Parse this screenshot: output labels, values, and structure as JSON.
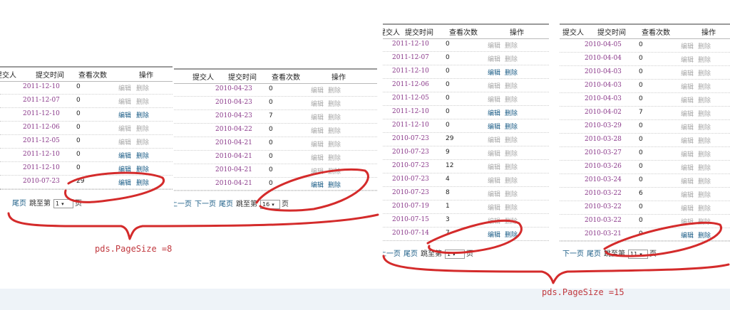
{
  "columns": {
    "submitter": "提交人",
    "time": "提交时间",
    "views": "查看次数",
    "ops": "操作"
  },
  "actions": {
    "edit": "编辑",
    "delete": "删除"
  },
  "pager": {
    "prev": "上一页",
    "next": "下一页",
    "last": "尾页",
    "goto": "跳至第",
    "page": "页"
  },
  "panels": [
    {
      "rows": [
        {
          "date": "2011-12-10",
          "views": "0",
          "active": false
        },
        {
          "date": "2011-12-07",
          "views": "0",
          "active": false
        },
        {
          "date": "2011-12-10",
          "views": "0",
          "active": true
        },
        {
          "date": "2011-12-06",
          "views": "0",
          "active": false
        },
        {
          "date": "2011-12-05",
          "views": "0",
          "active": false
        },
        {
          "date": "2011-12-10",
          "views": "0",
          "active": true
        },
        {
          "date": "2011-12-10",
          "views": "0",
          "active": true
        },
        {
          "date": "2010-07-23",
          "views": "29",
          "active": true
        }
      ],
      "page_select": "1"
    },
    {
      "rows": [
        {
          "date": "2010-04-23",
          "views": "0",
          "active": false
        },
        {
          "date": "2010-04-23",
          "views": "0",
          "active": false
        },
        {
          "date": "2010-04-23",
          "views": "7",
          "active": false
        },
        {
          "date": "2010-04-22",
          "views": "0",
          "active": false
        },
        {
          "date": "2010-04-21",
          "views": "0",
          "active": false
        },
        {
          "date": "2010-04-21",
          "views": "0",
          "active": false
        },
        {
          "date": "2010-04-21",
          "views": "0",
          "active": false
        },
        {
          "date": "2010-04-21",
          "views": "0",
          "active": true
        }
      ],
      "page_select": "16"
    },
    {
      "rows": [
        {
          "date": "2011-12-10",
          "views": "0",
          "active": false
        },
        {
          "date": "2011-12-07",
          "views": "0",
          "active": false
        },
        {
          "date": "2011-12-10",
          "views": "0",
          "active": true
        },
        {
          "date": "2011-12-06",
          "views": "0",
          "active": false
        },
        {
          "date": "2011-12-05",
          "views": "0",
          "active": false
        },
        {
          "date": "2011-12-10",
          "views": "0",
          "active": true
        },
        {
          "date": "2011-12-10",
          "views": "0",
          "active": true
        },
        {
          "date": "2010-07-23",
          "views": "29",
          "active": false
        },
        {
          "date": "2010-07-23",
          "views": "9",
          "active": false
        },
        {
          "date": "2010-07-23",
          "views": "12",
          "active": false
        },
        {
          "date": "2010-07-23",
          "views": "4",
          "active": false
        },
        {
          "date": "2010-07-23",
          "views": "8",
          "active": false
        },
        {
          "date": "2010-07-19",
          "views": "1",
          "active": false
        },
        {
          "date": "2010-07-15",
          "views": "3",
          "active": false
        },
        {
          "date": "2010-07-14",
          "views": "7",
          "active": true
        }
      ],
      "page_select": "1"
    },
    {
      "rows": [
        {
          "date": "2010-04-05",
          "views": "0",
          "active": false
        },
        {
          "date": "2010-04-04",
          "views": "0",
          "active": false
        },
        {
          "date": "2010-04-03",
          "views": "0",
          "active": false
        },
        {
          "date": "2010-04-03",
          "views": "0",
          "active": false
        },
        {
          "date": "2010-04-03",
          "views": "0",
          "active": false
        },
        {
          "date": "2010-04-02",
          "views": "7",
          "active": false
        },
        {
          "date": "2010-03-29",
          "views": "0",
          "active": false
        },
        {
          "date": "2010-03-28",
          "views": "0",
          "active": false
        },
        {
          "date": "2010-03-27",
          "views": "0",
          "active": false
        },
        {
          "date": "2010-03-26",
          "views": "0",
          "active": false
        },
        {
          "date": "2010-03-24",
          "views": "0",
          "active": false
        },
        {
          "date": "2010-03-22",
          "views": "6",
          "active": false
        },
        {
          "date": "2010-03-22",
          "views": "0",
          "active": false
        },
        {
          "date": "2010-03-22",
          "views": "0",
          "active": false
        },
        {
          "date": "2010-03-21",
          "views": "0",
          "active": true
        }
      ],
      "page_select": "11"
    }
  ],
  "notes": {
    "left": "pds.PageSize =8",
    "right": "pds.PageSize =15"
  },
  "colors": {
    "ink": "#d42b2b",
    "date": "#8b3a8b",
    "link": "#1a5c86",
    "disabled": "#a8a8a8"
  }
}
